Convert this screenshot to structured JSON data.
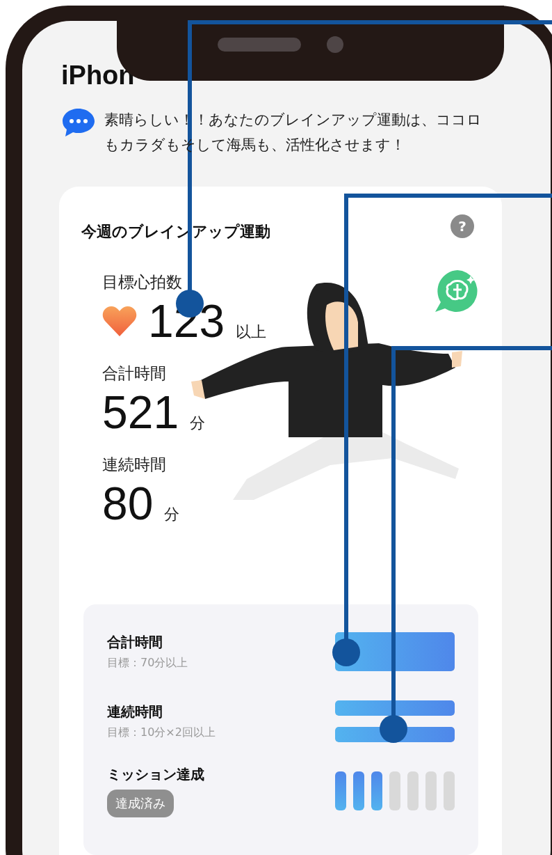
{
  "app_title": "iPhon",
  "message": "素晴らしい！！あなたのブレインアップ運動は、ココロもカラダもそして海馬も、活性化させます！",
  "card": {
    "title": "今週のブレインアップ運動",
    "help": "?",
    "stats": [
      {
        "kind": "heart",
        "label": "目標心拍数",
        "value": "123",
        "unit": "以上"
      },
      {
        "kind": "plain",
        "label": "合計時間",
        "value": "521",
        "unit": "分"
      },
      {
        "kind": "plain",
        "label": "連続時間",
        "value": "80",
        "unit": "分"
      }
    ],
    "goals": [
      {
        "kind": "bars",
        "title": "合計時間",
        "note": "目標：70分以上",
        "bars": [
          {
            "level": 1
          }
        ]
      },
      {
        "kind": "bars",
        "title": "連続時間",
        "note": "目標：10分×2回以上",
        "bars": [
          {
            "level": 1
          },
          {
            "level": 1
          }
        ]
      },
      {
        "kind": "steps",
        "title": "ミッション達成",
        "badge": "達成済み",
        "steps": [
          {
            "filled": true
          },
          {
            "filled": true
          },
          {
            "filled": true
          },
          {
            "filled": false
          },
          {
            "filled": false
          },
          {
            "filled": false
          },
          {
            "filled": false
          }
        ]
      }
    ]
  }
}
